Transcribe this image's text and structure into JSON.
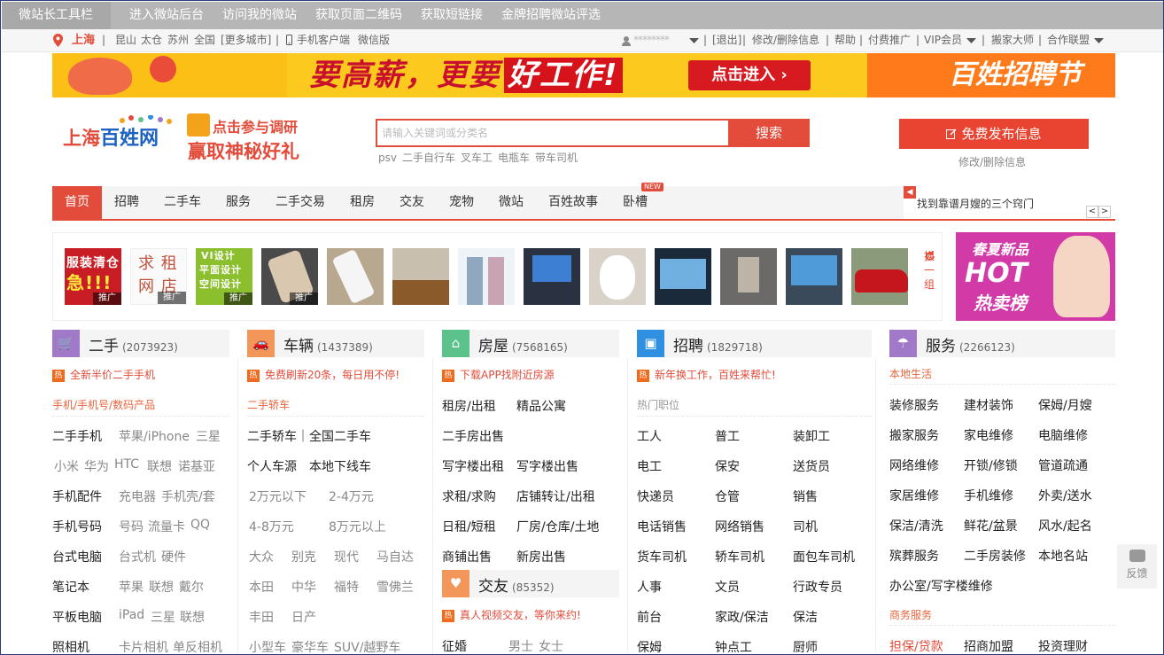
{
  "toolbar": {
    "title": "微站长工具栏",
    "links": [
      "进入微站后台",
      "访问我的微站",
      "获取页面二维码",
      "获取短链接",
      "金牌招聘微站评选"
    ]
  },
  "topbar": {
    "city": "上海",
    "nearby": [
      "昆山",
      "太仓",
      "苏州",
      "全国"
    ],
    "more_cities": "[更多城市]",
    "mobile": "手机客户端",
    "weixin": "微信版",
    "account_masked": "********",
    "logout": "[退出]",
    "links": [
      "修改/删除信息",
      "帮助",
      "付费推广",
      "VIP会员",
      "搬家大师",
      "合作联盟"
    ]
  },
  "banner": {
    "slogan": "要高薪，更要",
    "slogan_em": "好工作!",
    "cta": "点击进入 ›",
    "festival": "百姓招聘节"
  },
  "header": {
    "logo_city": "上海",
    "logo_brand": "百姓网",
    "promo_line1": "点击参与调研",
    "promo_line2": "赢取神秘好礼",
    "search_placeholder": "请输入关键词或分类名",
    "search_button": "搜索",
    "hot_words": [
      "psv",
      "二手自行车",
      "叉车工",
      "电瓶车",
      "带车司机"
    ],
    "publish_button": "免费发布信息",
    "publish_sub": "修改/删除信息"
  },
  "nav": {
    "items": [
      "首页",
      "招聘",
      "二手车",
      "服务",
      "二手交易",
      "租房",
      "交友",
      "宠物",
      "微站",
      "百姓故事",
      "卧槽"
    ],
    "new_badge": "NEW",
    "notice": "找到靠谱月嫂的三个窍门",
    "prev": "<",
    "next": ">"
  },
  "gallery": {
    "promo_tag": "推广",
    "t1_line1": "服装清仓",
    "t1_line2": "急!!!",
    "t2_line1": "求 租",
    "t2_line2": "网 店",
    "t3_line1": "VI设计",
    "t3_line2": "平面设计",
    "t3_line3": "空间设计",
    "change": "换一组",
    "ad_line1": "春夏新品",
    "ad_line2": "HOT",
    "ad_line3": "热卖榜"
  },
  "columns": {
    "ershou": {
      "title": "二手",
      "count": "(2073923)",
      "hot": "全新半价二手手机",
      "sub": "手机/手机号/数码产品",
      "rows": [
        [
          "二手手机",
          "苹果/iPhone",
          "三星"
        ],
        [
          "小米",
          "华为",
          "HTC",
          "联想",
          "诺基亚"
        ],
        [
          "手机配件",
          "充电器",
          "手机壳/套"
        ],
        [
          "手机号码",
          "号码",
          "流量卡",
          "QQ"
        ],
        [
          "台式电脑",
          "台式机",
          "硬件"
        ],
        [
          "笔记本",
          "苹果",
          "联想",
          "戴尔"
        ],
        [
          "平板电脑",
          "iPad",
          "三星",
          "联想"
        ],
        [
          "照相机",
          "卡片相机",
          "单反相机"
        ]
      ]
    },
    "cheliang": {
      "title": "车辆",
      "count": "(1437389)",
      "hot": "免费刷新20条，每日用不停!",
      "sub": "二手轿车",
      "rows": [
        [
          "二手轿车｜全国二手车"
        ],
        [
          "个人车源",
          "本地下线车"
        ],
        [
          "2万元以下",
          "2-4万元"
        ],
        [
          "4-8万元",
          "8万元以上"
        ],
        [
          "大众",
          "别克",
          "现代",
          "马自达"
        ],
        [
          "本田",
          "中华",
          "福特",
          "雪佛兰"
        ],
        [
          "丰田",
          "日产"
        ],
        [
          "小型车",
          "豪华车",
          "SUV/越野车"
        ]
      ]
    },
    "fangwu": {
      "title": "房屋",
      "count": "(7568165)",
      "hot": "下载APP找附近房源",
      "rows": [
        [
          "租房/出租",
          "精品公寓"
        ],
        [
          "二手房出售"
        ],
        [
          "写字楼出租",
          "写字楼出售"
        ],
        [
          "求租/求购",
          "店铺转让/出租"
        ],
        [
          "日租/短租",
          "厂房/仓库/土地"
        ],
        [
          "商铺出售",
          "新房出售"
        ]
      ]
    },
    "jiaoyou": {
      "title": "交友",
      "count": "(85352)",
      "hot": "真人视频交友，等你来约!",
      "rows": [
        [
          "征婚",
          "男士",
          "女士"
        ]
      ]
    },
    "zhaopin": {
      "title": "招聘",
      "count": "(1829718)",
      "hot": "新年换工作，百姓来帮忙!",
      "sub": "热门职位",
      "rows": [
        [
          "工人",
          "普工",
          "装卸工"
        ],
        [
          "电工",
          "保安",
          "送货员"
        ],
        [
          "快递员",
          "仓管",
          "销售"
        ],
        [
          "电话销售",
          "网络销售",
          "司机"
        ],
        [
          "货车司机",
          "轿车司机",
          "面包车司机"
        ],
        [
          "人事",
          "文员",
          "行政专员"
        ],
        [
          "前台",
          "家政/保洁",
          "保洁"
        ],
        [
          "保姆",
          "钟点工",
          "厨师"
        ]
      ]
    },
    "fuwu": {
      "title": "服务",
      "count": "(2266123)",
      "sub": "本地生活",
      "sub2": "商务服务",
      "rows": [
        [
          "装修服务",
          "建材装饰",
          "保姆/月嫂"
        ],
        [
          "搬家服务",
          "家电维修",
          "电脑维修"
        ],
        [
          "网络维修",
          "开锁/修锁",
          "管道疏通"
        ],
        [
          "家居维修",
          "手机维修",
          "外卖/送水"
        ],
        [
          "保洁/清洗",
          "鲜花/盆景",
          "风水/起名"
        ],
        [
          "殡葬服务",
          "二手房装修",
          "本地名站"
        ],
        [
          "办公室/写字楼维修"
        ]
      ],
      "rows2": [
        [
          "担保/贷款",
          "招商加盟",
          "投资理财"
        ]
      ]
    }
  },
  "feedback": "反馈",
  "hot_badge": "热",
  "colors": {
    "accent": "#e34b3a",
    "icon_purple": "#a07ac8",
    "icon_orange": "#f39659",
    "icon_green": "#5cc28c",
    "icon_blue": "#2f8fe0"
  },
  "icons": [
    "map-pin-icon",
    "phone-icon",
    "user-icon",
    "chevron-down-icon",
    "edit-icon",
    "speaker-icon",
    "refresh-icon",
    "cart-icon",
    "car-icon",
    "house-icon",
    "heart-icon",
    "briefcase-icon",
    "umbrella-icon",
    "chat-icon"
  ]
}
